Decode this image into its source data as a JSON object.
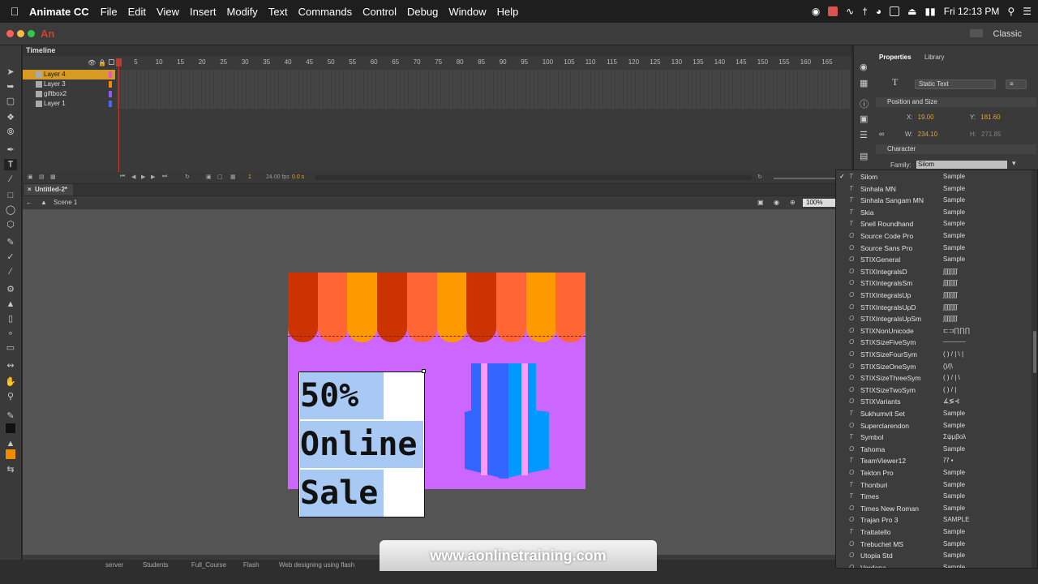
{
  "menubar": {
    "app_name": "Animate CC",
    "menus": [
      "File",
      "Edit",
      "View",
      "Insert",
      "Modify",
      "Text",
      "Commands",
      "Control",
      "Debug",
      "Window",
      "Help"
    ],
    "clock": "Fri 12:13 PM"
  },
  "appbar": {
    "logo": "An",
    "workspace": "Classic"
  },
  "timeline": {
    "title": "Timeline",
    "layers": [
      {
        "name": "Layer 4",
        "color": "#e754c9",
        "selected": true
      },
      {
        "name": "Layer 3",
        "color": "#f28b00",
        "selected": false
      },
      {
        "name": "giftbox2",
        "color": "#8b5cf6",
        "selected": false
      },
      {
        "name": "Layer 1",
        "color": "#4466ff",
        "selected": false
      }
    ],
    "ruler": [
      "1",
      "5",
      "10",
      "15",
      "20",
      "25",
      "30",
      "35",
      "40",
      "45",
      "50",
      "55",
      "60",
      "65",
      "70",
      "75",
      "80",
      "85",
      "90",
      "95",
      "100",
      "105",
      "110",
      "115",
      "120",
      "125",
      "130",
      "135",
      "140",
      "145",
      "150",
      "155",
      "160",
      "165"
    ],
    "frame": "1",
    "fps": "24.00 fps",
    "time": "0.0 s"
  },
  "document": {
    "tab": "Untitled-2*",
    "scene": "Scene 1",
    "zoom": "100%"
  },
  "stage": {
    "stripe_colors": [
      "#cc3300",
      "#ff6633",
      "#ff9900",
      "#cc3300",
      "#ff6633",
      "#ff9900",
      "#cc3300",
      "#ff6633",
      "#ff9900",
      "#ff6633"
    ],
    "background": "#cc66ff",
    "text_lines": [
      "50%",
      "Online",
      "Sale"
    ],
    "gift_colors": [
      "#3366ff",
      "#ff99ff",
      "#0099ff"
    ]
  },
  "finder": {
    "crumbs": [
      "server",
      "Students",
      "Full_Course",
      "Flash",
      "Web designing using flash"
    ]
  },
  "watermark": "www.aonlinetraining.com",
  "properties": {
    "tabs": [
      "Properties",
      "Library"
    ],
    "text_type": "Static Text",
    "position_section": "Position and Size",
    "x_label": "X:",
    "x": "19.00",
    "y_label": "Y:",
    "y": "181.60",
    "w_label": "W:",
    "w": "234.10",
    "h_label": "H:",
    "h": "271.85",
    "character_section": "Character",
    "family_label": "Family:",
    "family": "Silom"
  },
  "fontlist": {
    "items": [
      {
        "name": "Silom",
        "type": "T",
        "sample": "Sample",
        "checked": true
      },
      {
        "name": "Sinhala MN",
        "type": "T",
        "sample": "Sample"
      },
      {
        "name": "Sinhala Sangam MN",
        "type": "T",
        "sample": "Sample"
      },
      {
        "name": "Skia",
        "type": "T",
        "sample": "Sample"
      },
      {
        "name": "Snell Roundhand",
        "type": "T",
        "sample": "Sample"
      },
      {
        "name": "Source Code Pro",
        "type": "O",
        "sample": "Sample"
      },
      {
        "name": "Source Sans Pro",
        "type": "O",
        "sample": "Sample"
      },
      {
        "name": "STIXGeneral",
        "type": "O",
        "sample": "Sample"
      },
      {
        "name": "STIXIntegralsD",
        "type": "O",
        "sample": "∫∫∫∫∫∫∫∫"
      },
      {
        "name": "STIXIntegralsSm",
        "type": "O",
        "sample": "∫∫∫∫∫∫∫∫"
      },
      {
        "name": "STIXIntegralsUp",
        "type": "O",
        "sample": "∫∫∫∫∫∫∫∫"
      },
      {
        "name": "STIXIntegralsUpD",
        "type": "O",
        "sample": "∫∫∫∫∫∫∫∫"
      },
      {
        "name": "STIXIntegralsUpSm",
        "type": "O",
        "sample": "∫∫∫∫∫∫∫∫"
      },
      {
        "name": "STIXNonUnicode",
        "type": "O",
        "sample": "⊏⊐∏∏∏"
      },
      {
        "name": "STIXSizeFiveSym",
        "type": "O",
        "sample": "⎯⎯⎯⎯⎯⎯⎯"
      },
      {
        "name": "STIXSizeFourSym",
        "type": "O",
        "sample": "( ) / | \\ |"
      },
      {
        "name": "STIXSizeOneSym",
        "type": "O",
        "sample": "()/|\\"
      },
      {
        "name": "STIXSizeThreeSym",
        "type": "O",
        "sample": "( ) / | \\"
      },
      {
        "name": "STIXSizeTwoSym",
        "type": "O",
        "sample": "( ) / |"
      },
      {
        "name": "STIXVariants",
        "type": "O",
        "sample": "∡≶⊰"
      },
      {
        "name": "Sukhumvit Set",
        "type": "T",
        "sample": "Sample"
      },
      {
        "name": "Superclarendon",
        "type": "O",
        "sample": "Sample"
      },
      {
        "name": "Symbol",
        "type": "T",
        "sample": "Σψμβολ"
      },
      {
        "name": "Tahoma",
        "type": "O",
        "sample": "Sample"
      },
      {
        "name": "TeamViewer12",
        "type": "T",
        "sample": "⁇ ▪"
      },
      {
        "name": "Tekton Pro",
        "type": "O",
        "sample": "Sample"
      },
      {
        "name": "Thonburi",
        "type": "T",
        "sample": "Sample"
      },
      {
        "name": "Times",
        "type": "T",
        "sample": "Sample"
      },
      {
        "name": "Times New Roman",
        "type": "O",
        "sample": "Sample"
      },
      {
        "name": "Trajan Pro 3",
        "type": "O",
        "sample": "SAMPLE"
      },
      {
        "name": "Trattatello",
        "type": "T",
        "sample": "Sample"
      },
      {
        "name": "Trebuchet MS",
        "type": "O",
        "sample": "Sample"
      },
      {
        "name": "Utopia Std",
        "type": "O",
        "sample": "Sample"
      },
      {
        "name": "Verdana",
        "type": "O",
        "sample": "Sample"
      }
    ]
  }
}
